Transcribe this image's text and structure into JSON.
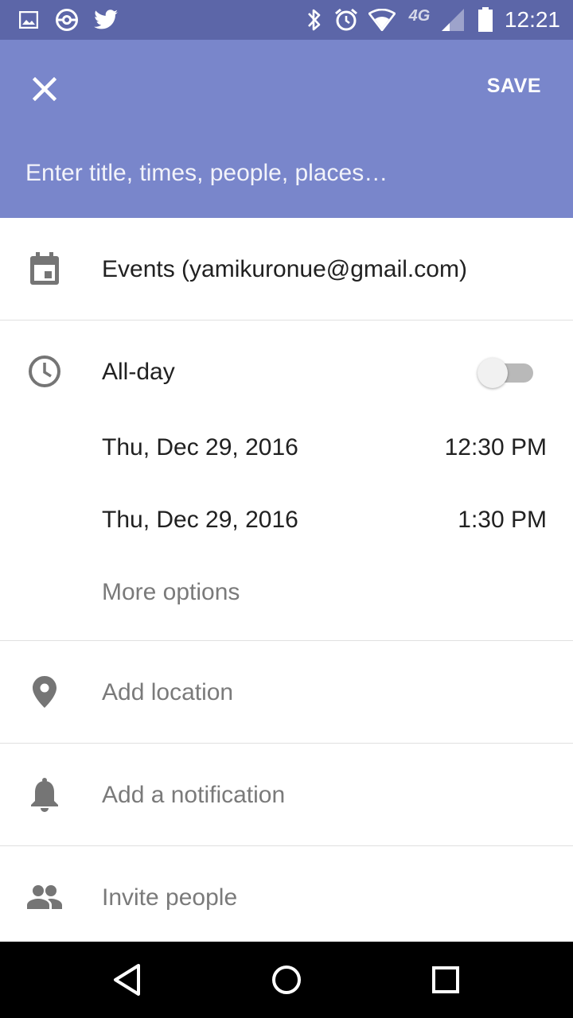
{
  "status_bar": {
    "time": "12:21",
    "network_label": "4G",
    "icons": [
      "image-notification-icon",
      "pokeball-icon",
      "twitter-icon",
      "bluetooth-icon",
      "alarm-icon",
      "wifi-icon",
      "4g-lte-icon",
      "cell-signal-icon",
      "battery-icon"
    ]
  },
  "app_bar": {
    "close_icon": "close-icon",
    "save_label": "SAVE",
    "title_placeholder": "Enter title, times, people, places…",
    "color": "#7986cb"
  },
  "calendar": {
    "icon": "calendar-icon",
    "label": "Events (yamikuronue@gmail.com)"
  },
  "time_section": {
    "icon": "clock-icon",
    "all_day_label": "All-day",
    "all_day_on": false,
    "start_date": "Thu, Dec 29, 2016",
    "start_time": "12:30 PM",
    "end_date": "Thu, Dec 29, 2016",
    "end_time": "1:30 PM",
    "more_options_label": "More options"
  },
  "location": {
    "icon": "location-pin-icon",
    "label": "Add location"
  },
  "notification": {
    "icon": "bell-icon",
    "label": "Add a notification"
  },
  "invite": {
    "icon": "people-icon",
    "label": "Invite people"
  },
  "nav_bar": {
    "buttons": [
      "back-icon",
      "home-icon",
      "recents-icon"
    ]
  }
}
